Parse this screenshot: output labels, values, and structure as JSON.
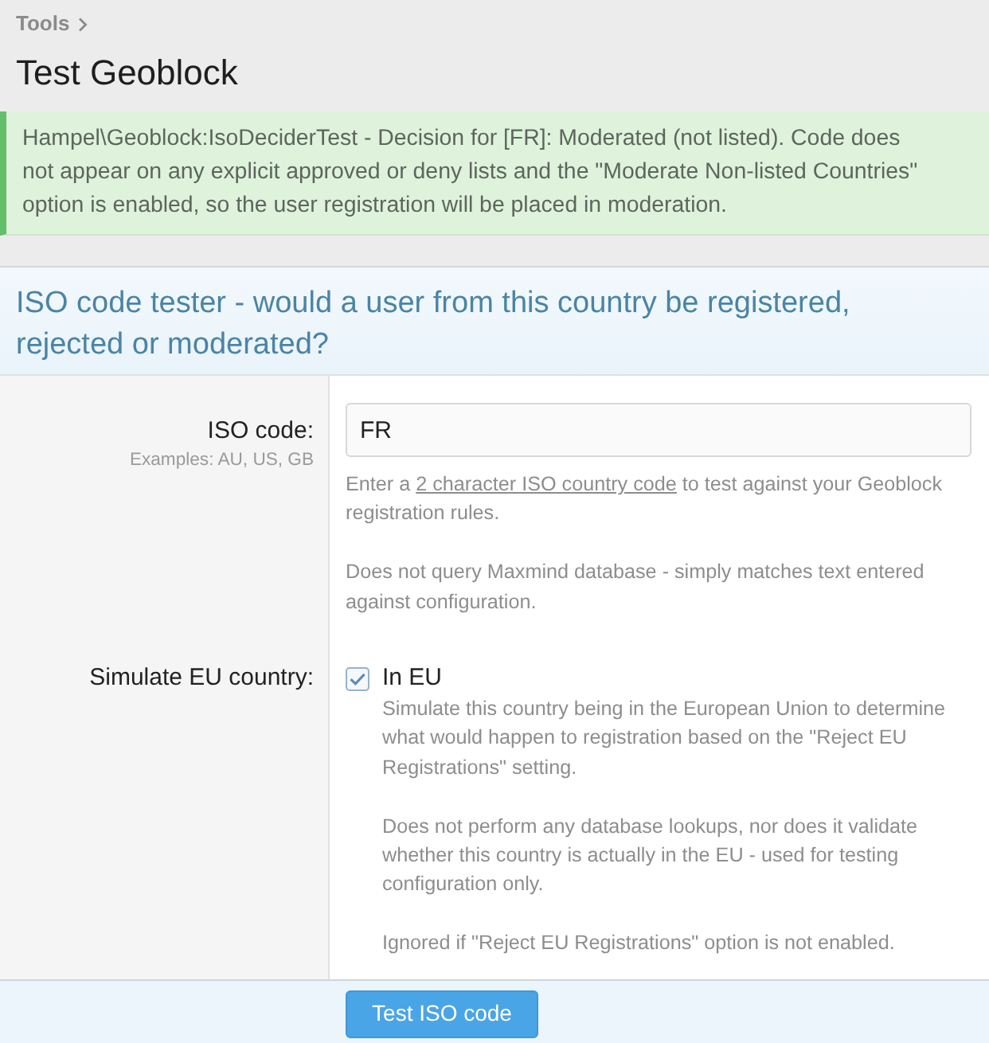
{
  "breadcrumb": [
    {
      "label": "Tools"
    }
  ],
  "page_title": "Test Geoblock",
  "alert": {
    "kind": "success",
    "text": "Hampel\\Geoblock:IsoDeciderTest - Decision for [FR]: Moderated (not listed). Code does not appear on any explicit approved or deny lists and the \"Moderate Non-listed Countries\" option is enabled, so the user registration will be placed in moderation."
  },
  "form": {
    "title": "ISO code tester - would a user from this country be registered, rejected or moderated?",
    "rows": [
      {
        "kind": "text",
        "label": "ISO code:",
        "hint": "Examples: AU, US, GB",
        "value": "FR",
        "explain": [
          {
            "text": "Enter a ",
            "link": "2 character ISO country code",
            "after": " to test against your Geoblock registration rules."
          },
          {
            "text": "Does not query Maxmind database - simply matches text entered against configuration."
          }
        ]
      },
      {
        "kind": "checkbox",
        "label": "Simulate EU country:",
        "option": {
          "label": "In EU",
          "checked": true
        },
        "explain": [
          {
            "text": "Simulate this country being in the European Union to determine what would happen to registration based on the \"Reject EU Registrations\" setting."
          },
          {
            "text": "Does not perform any database lookups, nor does it validate whether this country is actually in the EU - used for testing configuration only."
          },
          {
            "text": "Ignored if \"Reject EU Registrations\" option is not enabled."
          }
        ]
      }
    ],
    "submit": "Test ISO code"
  }
}
